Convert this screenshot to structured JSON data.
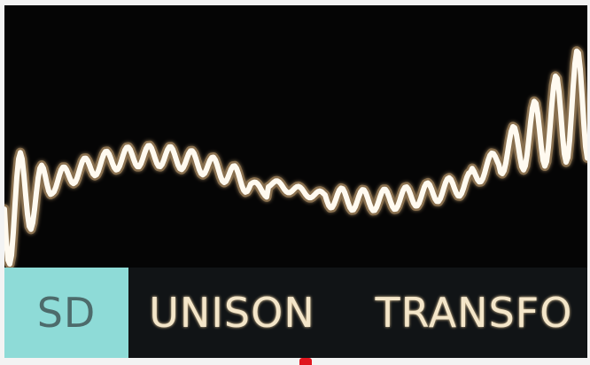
{
  "display": {
    "menu": {
      "selected_index": 0,
      "items": [
        {
          "label": "SD"
        },
        {
          "label": "UNISON"
        },
        {
          "label": "TRANSFO"
        }
      ]
    },
    "colors": {
      "screen_bg": "#050505",
      "waveform": "#fffaf0",
      "waveform_glow": "#f6c98c",
      "selected_bg": "#8edbd7",
      "menu_text": "#f4e6c9"
    }
  }
}
